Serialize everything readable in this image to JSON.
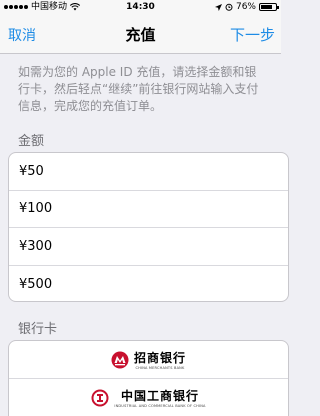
{
  "status_bar": {
    "carrier": "中国移动",
    "wifi_icon": "wifi-icon",
    "time": "14:30",
    "battery_percent": "76%",
    "battery_level": 0.76
  },
  "nav": {
    "cancel_label": "取消",
    "title": "充值",
    "next_label": "下一步"
  },
  "description": "如需为您的 Apple ID 充值，请选择金额和银行卡，然后轻点“继续”前往银行网站输入支付信息，完成您的充值订单。",
  "amount_section": {
    "header": "金额",
    "options": [
      "¥50",
      "¥100",
      "¥300",
      "¥500"
    ]
  },
  "bank_section": {
    "header": "银行卡",
    "banks": [
      {
        "name": "招商银行",
        "sub": "CHINA MERCHANTS BANK",
        "logo_color": "#c8102e",
        "logo_icon": "cmb-logo-icon"
      },
      {
        "name": "中国工商银行",
        "sub": "INDUSTRIAL AND COMMERCIAL BANK OF CHINA",
        "logo_color": "#c8102e",
        "logo_icon": "icbc-logo-icon"
      }
    ]
  }
}
